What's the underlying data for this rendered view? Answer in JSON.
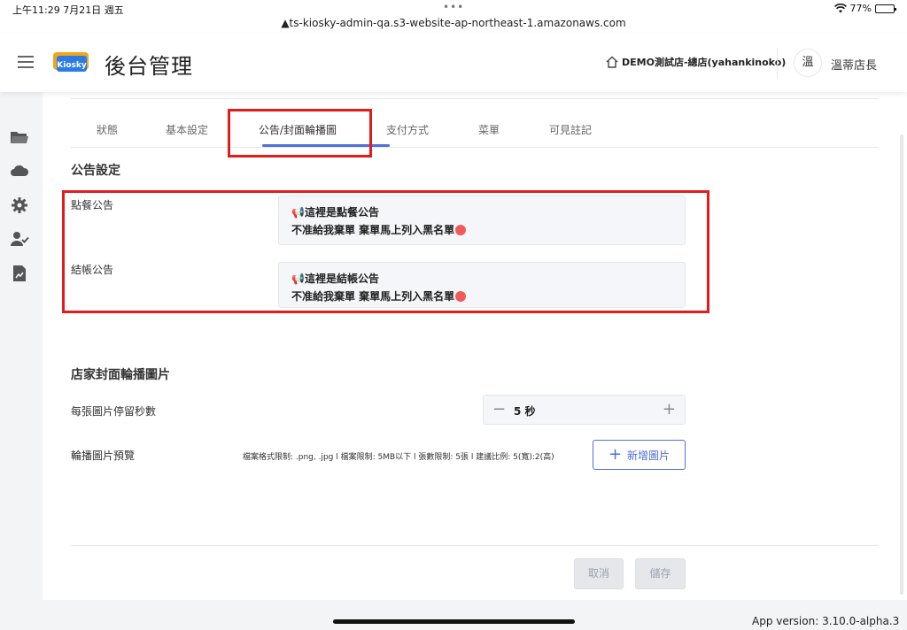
{
  "status_bar": {
    "time": "上午11:29  7月21日 週五",
    "url": "▲ts-kiosky-admin-qa.s3-website-ap-northeast-1.amazonaws.com",
    "battery_percent": "77%",
    "battery_level": 0.77,
    "dots": "•••"
  },
  "header": {
    "title": "後台管理",
    "logo_text": "Kiosky",
    "store_name": "DEMO測試店-總店(yahankinoko)",
    "avatar_text": "溫",
    "user_name": "溫蒂店長"
  },
  "sidebar": {
    "icons": [
      "folder-icon",
      "cloud-icon",
      "gear-icon",
      "user-check-icon",
      "report-icon"
    ]
  },
  "tabs": [
    {
      "label": "狀態",
      "active": false
    },
    {
      "label": "基本設定",
      "active": false
    },
    {
      "label": "公告/封面輪播圖",
      "active": true
    },
    {
      "label": "支付方式",
      "active": false
    },
    {
      "label": "菜單",
      "active": false
    },
    {
      "label": "可見註記"
    }
  ],
  "announcement": {
    "section_title": "公告設定",
    "order_label": "點餐公告",
    "order_line1": "📢這裡是點餐公告",
    "order_line2": "不准給我棄單 棄單馬上列入黑名單",
    "checkout_label": "結帳公告",
    "checkout_line1": "📢這裡是結帳公告",
    "checkout_line2": "不准給我棄單 棄單馬上列入黑名單"
  },
  "carousel": {
    "section_title": "店家封面輪播圖片",
    "duration_label": "每張圖片停留秒數",
    "duration_value": "5 秒",
    "minus": "−",
    "plus": "+",
    "preview_label": "輪播圖片預覽",
    "limits_hint": "檔案格式限制: .png, .jpg l 檔案限制: 5MB以下 l 張數限制: 5張 l 建議比例: 5(寬):2(高)",
    "add_button": "新增圖片",
    "add_plus": "+"
  },
  "footer": {
    "cancel": "取消",
    "save": "儲存"
  },
  "app_version": "App version: 3.10.0-alpha.3",
  "colors": {
    "accent": "#4f6fd9",
    "annotation_red": "#e21b1b",
    "logo_orange": "#f2a51a",
    "logo_blue": "#2c7be5"
  }
}
